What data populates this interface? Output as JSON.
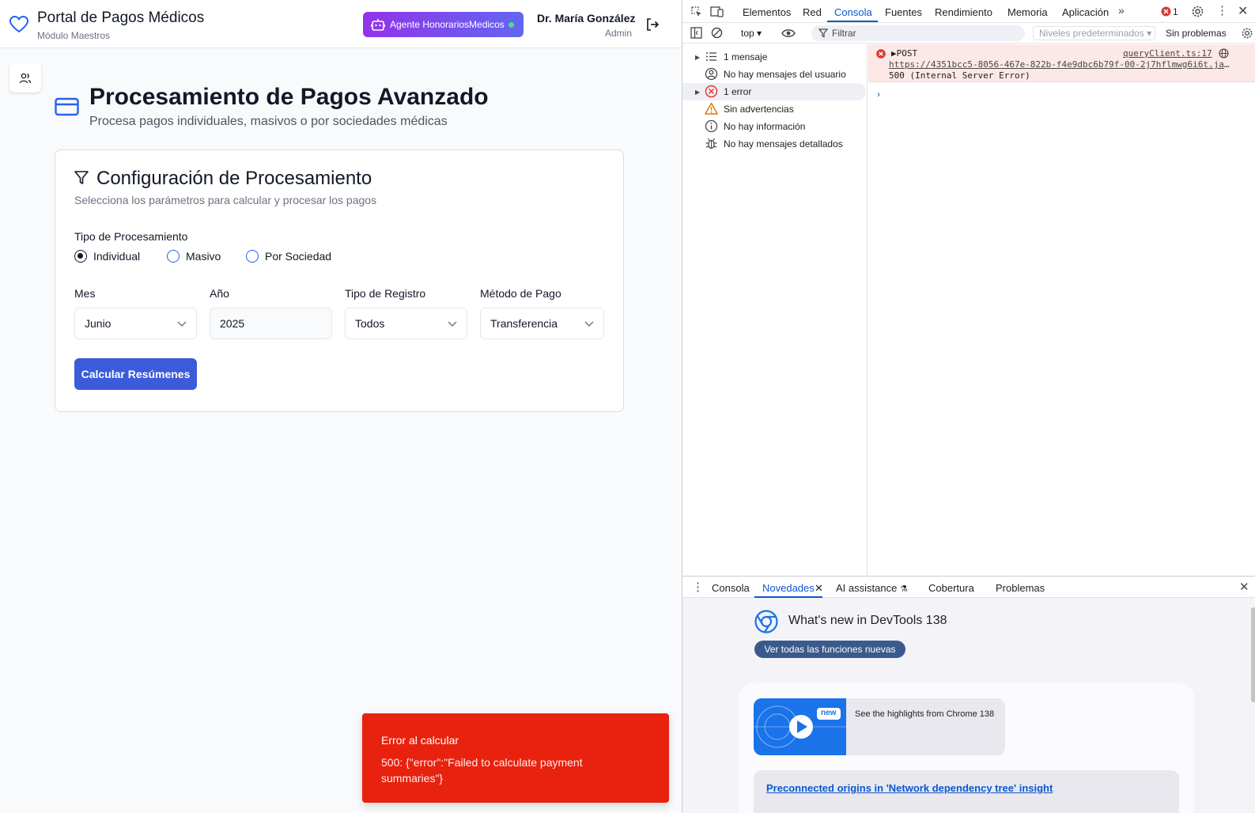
{
  "app": {
    "brand_title": "Portal de Pagos Médicos",
    "brand_subtitle": "Módulo Maestros",
    "agent_button": "Agente HonorariosMedicos",
    "user_name": "Dr. María González",
    "user_role": "Admin"
  },
  "page": {
    "title": "Procesamiento de Pagos Avanzado",
    "subtitle": "Procesa pagos individuales, masivos o por sociedades médicas"
  },
  "config_card": {
    "title": "Configuración de Procesamiento",
    "subtitle": "Selecciona los parámetros para calcular y procesar los pagos",
    "processing_type_label": "Tipo de Procesamiento",
    "processing_options": [
      {
        "label": "Individual",
        "selected": true
      },
      {
        "label": "Masivo",
        "selected": false
      },
      {
        "label": "Por Sociedad",
        "selected": false
      }
    ],
    "fields": {
      "month_label": "Mes",
      "month_value": "Junio",
      "year_label": "Año",
      "year_value": "2025",
      "record_type_label": "Tipo de Registro",
      "record_type_value": "Todos",
      "payment_method_label": "Método de Pago",
      "payment_method_value": "Transferencia"
    },
    "calculate_button": "Calcular Resúmenes"
  },
  "toast": {
    "title": "Error al calcular",
    "message": "500: {\"error\":\"Failed to calculate payment summaries\"}"
  },
  "devtools": {
    "tabs": [
      "Elementos",
      "Red",
      "Consola",
      "Fuentes",
      "Rendimiento",
      "Memoria",
      "Aplicación"
    ],
    "active_tab": "Consola",
    "error_count": "1",
    "context_select": "top",
    "filter_placeholder": "Filtrar",
    "levels_select": "Niveles predeterminados",
    "issues_text": "Sin problemas",
    "sidebar": [
      {
        "label": "1 mensaje",
        "icon": "list-icon",
        "expandable": true
      },
      {
        "label": "No hay mensajes del usuario",
        "icon": "user-circle-icon",
        "expandable": false
      },
      {
        "label": "1 error",
        "icon": "error-circle-icon",
        "expandable": true,
        "selected": true
      },
      {
        "label": "Sin advertencias",
        "icon": "warning-icon",
        "expandable": false
      },
      {
        "label": "No hay información",
        "icon": "info-icon",
        "expandable": false
      },
      {
        "label": "No hay mensajes detallados",
        "icon": "bug-icon",
        "expandable": false
      }
    ],
    "console_error": {
      "method": "POST",
      "source": "queryClient.ts:17",
      "url": "https://4351bcc5-8056-467e-822b-f4e9dbc6b79f-00-2j7hflmwg6i6t.jan…",
      "status": "500 (Internal Server Error)"
    },
    "drawer_tabs": [
      "Consola",
      "Novedades",
      "AI assistance",
      "Cobertura",
      "Problemas"
    ],
    "active_drawer_tab": "Novedades",
    "whats_new": {
      "title": "What's new in DevTools 138",
      "button": "Ver todas las funciones nuevas",
      "badge": "new",
      "highlight": "See the highlights from Chrome 138",
      "link": "Preconnected origins in 'Network dependency tree' insight"
    }
  },
  "colors": {
    "primary": "#3b5bdb",
    "toast_bg": "#e8220f",
    "agent_gradient_start": "#9333ea",
    "agent_gradient_end": "#6366f1",
    "devtools_accent": "#0b57d0"
  }
}
